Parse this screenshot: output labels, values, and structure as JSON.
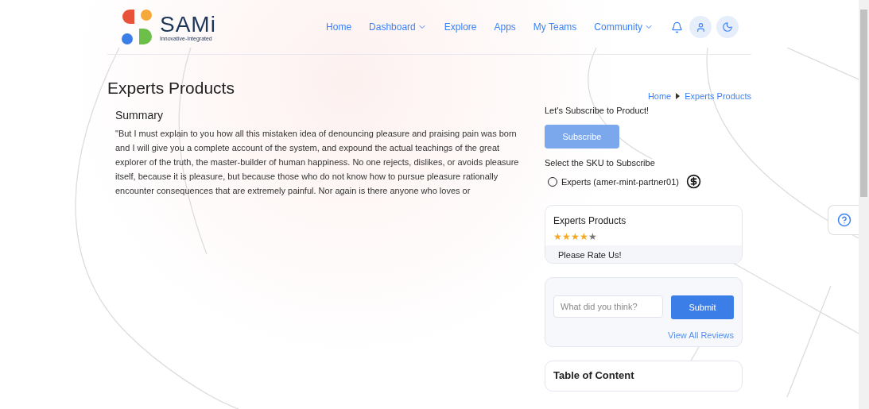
{
  "logo": {
    "name": "SAMi",
    "tagline": "Innovative-Integrated"
  },
  "nav": [
    {
      "label": "Home",
      "dropdown": false
    },
    {
      "label": "Dashboard",
      "dropdown": true
    },
    {
      "label": "Explore",
      "dropdown": false
    },
    {
      "label": "Apps",
      "dropdown": false
    },
    {
      "label": "My Teams",
      "dropdown": false
    },
    {
      "label": "Community",
      "dropdown": true
    }
  ],
  "page_title": "Experts Products",
  "breadcrumb": [
    "Home",
    "Experts Products"
  ],
  "summary": {
    "heading": "Summary",
    "text": "\"But I must explain to you how all this mistaken idea of denouncing pleasure and praising pain was born and I will give you a complete account of the system, and expound the actual teachings of the great explorer of the truth, the master-builder of human happiness. No one rejects, dislikes, or avoids pleasure itself, because it is pleasure, but because those who do not know how to pursue pleasure rationally encounter consequences that are extremely painful. Nor again is there anyone who loves or"
  },
  "subscribe": {
    "prompt": "Let's Subscribe to Product!",
    "button": "Subscribe",
    "disabled": true,
    "sku_label": "Select the SKU to Subscribe",
    "skus": [
      {
        "label": "Experts (amer-mint-partner01)",
        "selected": false
      }
    ]
  },
  "rating_card": {
    "title": "Experts Products",
    "stars": 4,
    "footer": "Please Rate Us!"
  },
  "review": {
    "placeholder": "What did you think?",
    "button": "Submit",
    "link": "View All Reviews"
  },
  "toc": {
    "title": "Table of Content"
  }
}
